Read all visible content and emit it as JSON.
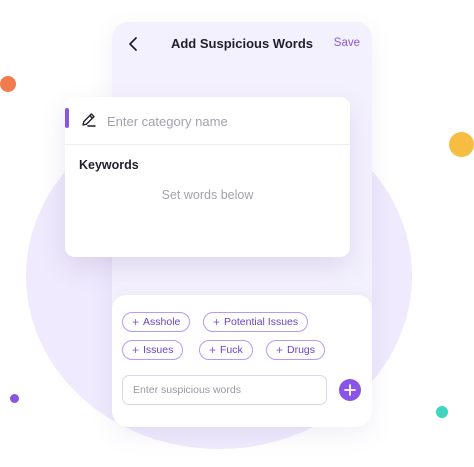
{
  "header": {
    "title": "Add Suspicious Words",
    "save_label": "Save",
    "back_icon": "chevron-left-icon"
  },
  "category": {
    "placeholder": "Enter category name",
    "icon": "pencil-icon"
  },
  "keywords": {
    "heading": "Keywords",
    "empty_text": "Set words below"
  },
  "suspicious_words": [
    {
      "label": "Asshole"
    },
    {
      "label": "Potential Issues"
    },
    {
      "label": "Issues"
    },
    {
      "label": "Fuck"
    },
    {
      "label": "Drugs"
    }
  ],
  "word_input": {
    "placeholder": "Enter suspicious words",
    "add_icon": "plus-icon"
  },
  "colors": {
    "accent": "#8a55e6",
    "background_circle": "#efeafd",
    "dot_orange": "#f27b4d",
    "dot_yellow": "#f7bd42",
    "dot_teal": "#41d4c1"
  }
}
